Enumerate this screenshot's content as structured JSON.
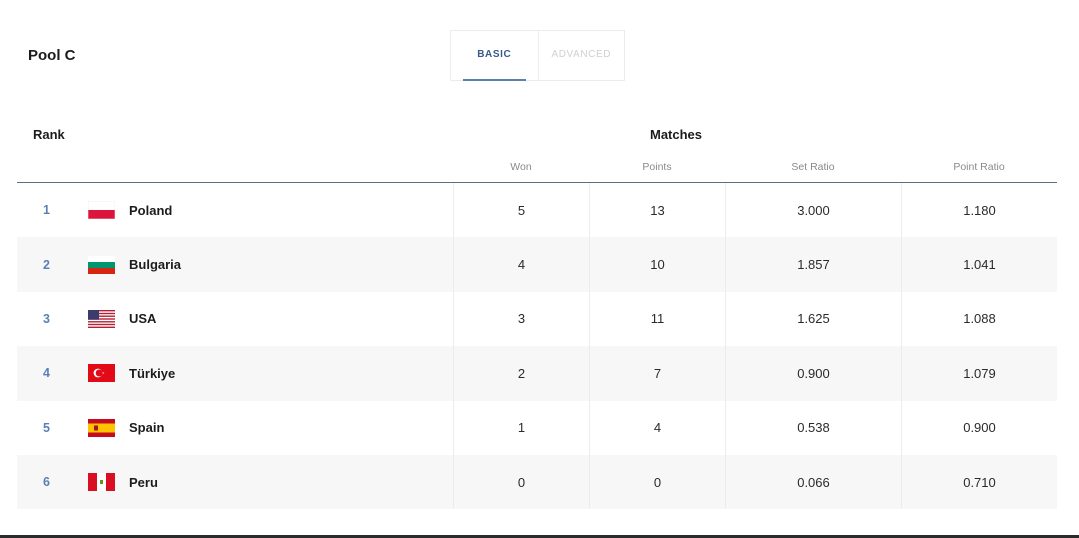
{
  "pool": {
    "title": "Pool C"
  },
  "tabs": [
    {
      "label": "BASIC",
      "active": true
    },
    {
      "label": "ADVANCED",
      "active": false
    }
  ],
  "table": {
    "rank_header": "Rank",
    "group_header": "Matches",
    "columns": [
      "Won",
      "Points",
      "Set Ratio",
      "Point Ratio"
    ],
    "rows": [
      {
        "rank": "1",
        "country": "Poland",
        "flag": "poland-flag-icon",
        "won": "5",
        "points": "13",
        "set_ratio": "3.000",
        "point_ratio": "1.180"
      },
      {
        "rank": "2",
        "country": "Bulgaria",
        "flag": "bulgaria-flag-icon",
        "won": "4",
        "points": "10",
        "set_ratio": "1.857",
        "point_ratio": "1.041"
      },
      {
        "rank": "3",
        "country": "USA",
        "flag": "usa-flag-icon",
        "won": "3",
        "points": "11",
        "set_ratio": "1.625",
        "point_ratio": "1.088"
      },
      {
        "rank": "4",
        "country": "Türkiye",
        "flag": "turkiye-flag-icon",
        "won": "2",
        "points": "7",
        "set_ratio": "0.900",
        "point_ratio": "1.079"
      },
      {
        "rank": "5",
        "country": "Spain",
        "flag": "spain-flag-icon",
        "won": "1",
        "points": "4",
        "set_ratio": "0.538",
        "point_ratio": "0.900"
      },
      {
        "rank": "6",
        "country": "Peru",
        "flag": "peru-flag-icon",
        "won": "0",
        "points": "0",
        "set_ratio": "0.066",
        "point_ratio": "0.710"
      }
    ]
  },
  "colors": {
    "accent": "#5b80b4",
    "rule": "#5a6f86",
    "row_shade": "#f7f7f7"
  }
}
